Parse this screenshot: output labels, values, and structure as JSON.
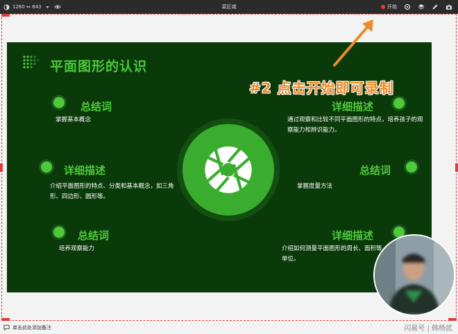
{
  "toolbar": {
    "resolution": "1260 ⇔ 843",
    "window_title": "菜区城",
    "record_label": "开始"
  },
  "slide": {
    "title": "平面图形的认识",
    "blocks": [
      {
        "title": "总结词",
        "text": "掌握基本概念"
      },
      {
        "title": "详细描述",
        "text": "介绍平面图形的特点、分类和基本概念，如三角形、四边形、圆形等。"
      },
      {
        "title": "总结词",
        "text": "培养观察能力"
      },
      {
        "title": "详细描述",
        "text": "通过观察和比较不同平面图形的特点，培养孩子的观察能力和辨识能力。"
      },
      {
        "title": "总结词",
        "text": "掌握度量方法"
      },
      {
        "title": "详细描述",
        "text": "介绍如何测量平面图形的周长、面积等，以及度量单位。"
      }
    ]
  },
  "annotation": {
    "text": "#2 点击开始即可录制"
  },
  "bottombar": {
    "note_text": "单击此处添加备注"
  },
  "watermark": {
    "text": "闪易号 | 韩杨武"
  },
  "colors": {
    "slide_bg": "#0a3a09",
    "accent_green": "#4ec93b",
    "annotation_orange": "#f08a24",
    "record_red": "#e53935"
  },
  "icons": [
    "theme-icon",
    "chevron-down-icon",
    "eye-icon",
    "record-dot-icon",
    "screenshot-area-icon",
    "layers-icon",
    "pen-icon",
    "camera-icon",
    "aperture-icon",
    "comment-icon"
  ]
}
